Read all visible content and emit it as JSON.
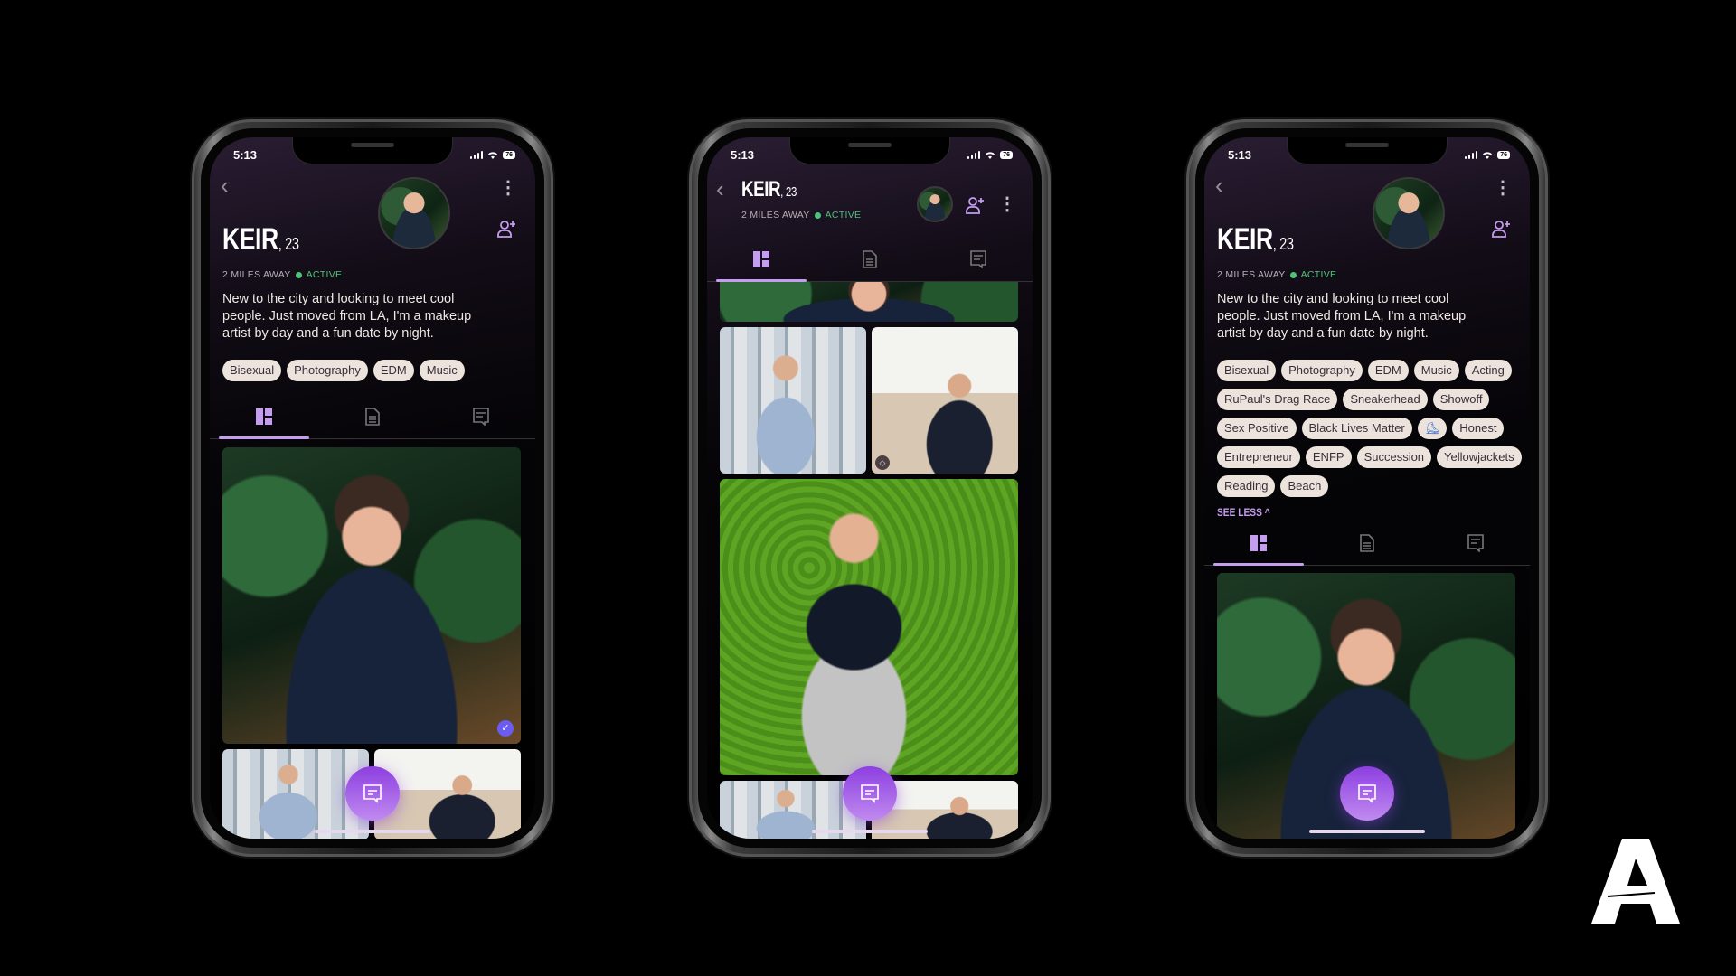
{
  "status_bar": {
    "time": "5:13",
    "battery": "76"
  },
  "profile": {
    "name": "KEIR",
    "age": ", 23",
    "distance": "2 MILES AWAY",
    "status": "ACTIVE",
    "bio": "New to the city and looking to meet cool people. Just moved from LA, I'm a makeup artist by day and a fun date by night."
  },
  "tags_collapsed": [
    "Bisexual",
    "Photography",
    "EDM",
    "Music"
  ],
  "tags_expanded": [
    "Bisexual",
    "Photography",
    "EDM",
    "Music",
    "Acting",
    "RuPaul's Drag Race",
    "Sneakerhead",
    "Showoff",
    "Sex Positive",
    "Black Lives Matter",
    "⛸",
    "Honest",
    "Entrepreneur",
    "ENFP",
    "Succession",
    "Yellowjackets",
    "Reading",
    "Beach"
  ],
  "see_less": "SEE LESS ^",
  "tabs": [
    {
      "icon": "photos-grid-icon",
      "active": true
    },
    {
      "icon": "document-icon",
      "active": false
    },
    {
      "icon": "message-icon",
      "active": false
    }
  ],
  "icons": {
    "back": "‹",
    "kebab": "⋮",
    "verified": "✓",
    "tag_badge": "◇"
  },
  "colors": {
    "accent": "#c49cf0",
    "active_green": "#4fc27a",
    "tag_bg": "#ece4dc",
    "fab_top": "#8d3fe0",
    "fab_bottom": "#c08af0"
  }
}
